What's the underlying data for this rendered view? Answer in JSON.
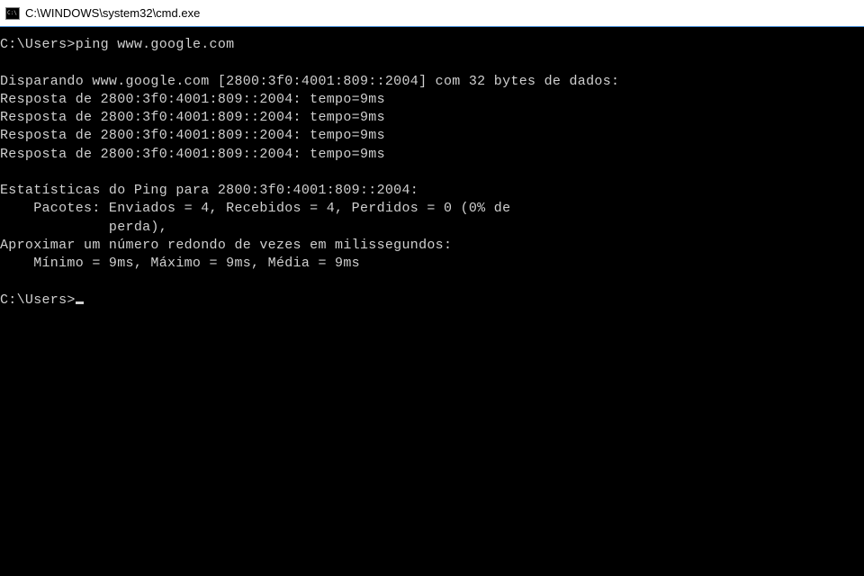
{
  "titlebar": {
    "title": "C:\\WINDOWS\\system32\\cmd.exe"
  },
  "terminal": {
    "prompt1": "C:\\Users>",
    "command": "ping www.google.com",
    "blank1": "",
    "line_disparando": "Disparando www.google.com [2800:3f0:4001:809::2004] com 32 bytes de dados:",
    "line_resposta1": "Resposta de 2800:3f0:4001:809::2004: tempo=9ms",
    "line_resposta2": "Resposta de 2800:3f0:4001:809::2004: tempo=9ms",
    "line_resposta3": "Resposta de 2800:3f0:4001:809::2004: tempo=9ms",
    "line_resposta4": "Resposta de 2800:3f0:4001:809::2004: tempo=9ms",
    "blank2": "",
    "line_stats_header": "Estatísticas do Ping para 2800:3f0:4001:809::2004:",
    "line_pacotes": "    Pacotes: Enviados = 4, Recebidos = 4, Perdidos = 0 (0% de",
    "line_perda": "             perda),",
    "line_aproximar": "Aproximar um número redondo de vezes em milissegundos:",
    "line_minmax": "    Mínimo = 9ms, Máximo = 9ms, Média = 9ms",
    "blank3": "",
    "prompt2": "C:\\Users>"
  }
}
